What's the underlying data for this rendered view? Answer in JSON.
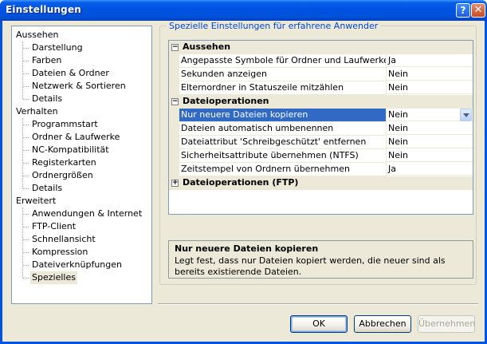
{
  "window": {
    "title": "Einstellungen",
    "help_glyph": "?",
    "close_glyph": "✕"
  },
  "tree": {
    "items": [
      {
        "label": "Aussehen",
        "level": 0
      },
      {
        "label": "Darstellung",
        "level": 1
      },
      {
        "label": "Farben",
        "level": 1
      },
      {
        "label": "Dateien & Ordner",
        "level": 1
      },
      {
        "label": "Netzwerk & Sortieren",
        "level": 1
      },
      {
        "label": "Details",
        "level": 1
      },
      {
        "label": "Verhalten",
        "level": 0
      },
      {
        "label": "Programmstart",
        "level": 1
      },
      {
        "label": "Ordner & Laufwerke",
        "level": 1
      },
      {
        "label": "NC-Kompatibilität",
        "level": 1
      },
      {
        "label": "Registerkarten",
        "level": 1
      },
      {
        "label": "Ordnergrößen",
        "level": 1
      },
      {
        "label": "Details",
        "level": 1
      },
      {
        "label": "Erweitert",
        "level": 0
      },
      {
        "label": "Anwendungen & Internet",
        "level": 1
      },
      {
        "label": "FTP-Client",
        "level": 1
      },
      {
        "label": "Schnellansicht",
        "level": 1
      },
      {
        "label": "Kompression",
        "level": 1
      },
      {
        "label": "Dateiverknüpfungen",
        "level": 1
      },
      {
        "label": "Spezielles",
        "level": 1,
        "selected": true
      }
    ]
  },
  "group": {
    "title": "Spezielle Einstellungen für erfahrene Anwender"
  },
  "grid": {
    "cat1": {
      "label": "Aussehen",
      "toggle": "−"
    },
    "rows1": [
      {
        "name": "Angepasste Symbole für Ordner und Laufwerke",
        "value": "Ja"
      },
      {
        "name": "Sekunden anzeigen",
        "value": "Nein"
      },
      {
        "name": "Elternordner in Statuszeile mitzählen",
        "value": "Nein"
      }
    ],
    "cat2": {
      "label": "Dateioperationen",
      "toggle": "−"
    },
    "rows2": [
      {
        "name": "Nur neuere Dateien kopieren",
        "value": "Nein",
        "selected": true
      },
      {
        "name": "Dateien automatisch umbenennen",
        "value": "Nein"
      },
      {
        "name": "Dateiattribut 'Schreibgeschützt' entfernen",
        "value": "Nein"
      },
      {
        "name": "Sicherheitsattribute übernehmen (NTFS)",
        "value": "Nein"
      },
      {
        "name": "Zeitstempel von Ordnern übernehmen",
        "value": "Ja"
      }
    ],
    "cat3": {
      "label": "Dateioperationen (FTP)",
      "toggle": "+"
    }
  },
  "help": {
    "title": "Nur neuere Dateien kopieren",
    "text": "Legt fest, dass nur Dateien kopiert werden, die neuer sind als bereits existierende Dateien."
  },
  "buttons": {
    "ok": "OK",
    "cancel": "Abbrechen",
    "apply": "Übernehmen"
  },
  "colors": {
    "selection": "#316ac5",
    "titlebar": "#0054e3",
    "group_title": "#0046d5"
  }
}
